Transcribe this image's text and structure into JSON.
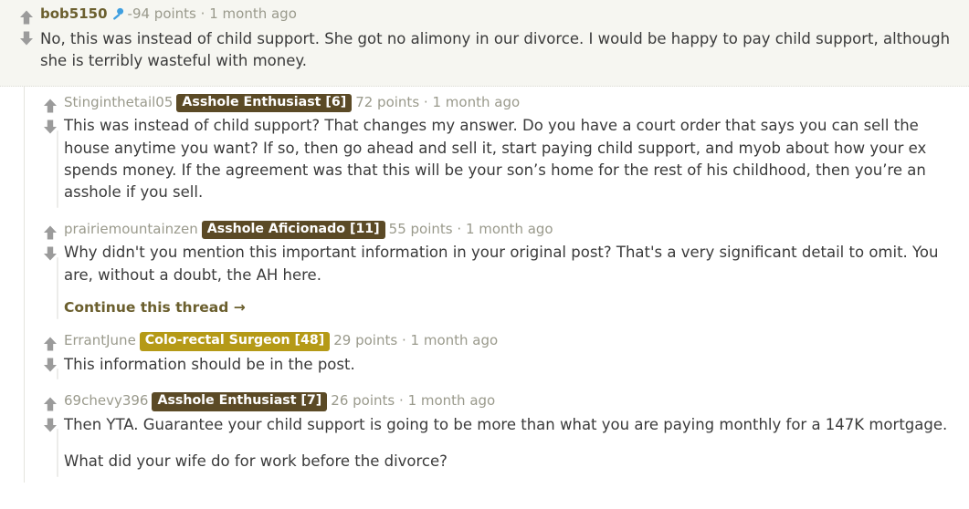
{
  "colors": {
    "op_background": "#f6f6f1",
    "op_author": "#6b5f2e",
    "author_muted": "#9a9a8c",
    "body_text": "#3a3a3a",
    "arrow_gray": "#9b9b9b",
    "mic_blue": "#3f9fe0",
    "flair_brown": "#5b4a26",
    "flair_gold": "#b59a17",
    "continue_link": "#6b5f2e",
    "thread_line": "#e4e4de"
  },
  "icons": {
    "upvote": "upvote-arrow-icon",
    "downvote": "downvote-arrow-icon",
    "op_badge": "microphone-icon",
    "continue_arrow": "arrow-right-icon"
  },
  "op_comment": {
    "author": "bob5150",
    "is_op": true,
    "op_badge_label": "OP",
    "points": "-94 points",
    "separator": "·",
    "age": "1 month ago",
    "paragraphs": [
      "No, this was instead of child support. She got no alimony in our divorce. I would be happy to pay child support, although she is terribly wasteful with money."
    ]
  },
  "replies": [
    {
      "author": "Stinginthetail05",
      "flair": {
        "label": "Asshole Enthusiast [6]",
        "color": "#5b4a26"
      },
      "points": "72 points",
      "separator": "·",
      "age": "1 month ago",
      "paragraphs": [
        "This was instead of child support? That changes my answer. Do you have a court order that says you can sell the house anytime you want? If so, then go ahead and sell it, start paying child support, and myob about how your ex spends money. If the agreement was that this will be your son’s home for the rest of his childhood, then you’re an asshole if you sell."
      ],
      "continue_thread": null
    },
    {
      "author": "prairiemountainzen",
      "flair": {
        "label": "Asshole Aficionado [11]",
        "color": "#5b4a26"
      },
      "points": "55 points",
      "separator": "·",
      "age": "1 month ago",
      "paragraphs": [
        "Why didn't you mention this important information in your original post? That's a very significant detail to omit. You are, without a doubt, the AH here."
      ],
      "continue_thread": "Continue this thread →"
    },
    {
      "author": "ErrantJune",
      "flair": {
        "label": "Colo-rectal Surgeon [48]",
        "color": "#b59a17"
      },
      "points": "29 points",
      "separator": "·",
      "age": "1 month ago",
      "paragraphs": [
        "This information should be in the post."
      ],
      "continue_thread": null
    },
    {
      "author": "69chevy396",
      "flair": {
        "label": "Asshole Enthusiast [7]",
        "color": "#5b4a26"
      },
      "points": "26 points",
      "separator": "·",
      "age": "1 month ago",
      "paragraphs": [
        "Then YTA. Guarantee your child support is going to be more than what you are paying monthly for a 147K mortgage.",
        "What did your wife do for work before the divorce?"
      ],
      "continue_thread": null
    }
  ]
}
